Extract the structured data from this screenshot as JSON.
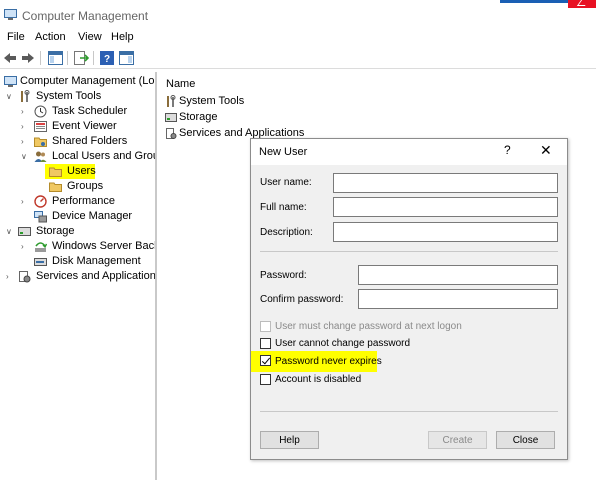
{
  "window": {
    "title": "Computer Management"
  },
  "menu": [
    "File",
    "Action",
    "View",
    "Help"
  ],
  "tree": {
    "root": "Computer Management (Local",
    "system_tools": "System Tools",
    "task_scheduler": "Task Scheduler",
    "event_viewer": "Event Viewer",
    "shared_folders": "Shared Folders",
    "local_users_groups": "Local Users and Groups",
    "users": "Users",
    "groups": "Groups",
    "performance": "Performance",
    "device_manager": "Device Manager",
    "storage": "Storage",
    "windows_server_backup": "Windows Server Backup",
    "disk_management": "Disk Management",
    "services_apps": "Services and Applications"
  },
  "list": {
    "header": "Name",
    "items": [
      "System Tools",
      "Storage",
      "Services and Applications"
    ]
  },
  "dialog": {
    "title": "New User",
    "help_glyph": "?",
    "close_glyph": "✕",
    "fields": {
      "user_name": {
        "label": "User name:",
        "value": ""
      },
      "full_name": {
        "label": "Full name:",
        "value": ""
      },
      "description": {
        "label": "Description:",
        "value": ""
      },
      "password": {
        "label": "Password:",
        "value": ""
      },
      "confirm_password": {
        "label": "Confirm password:",
        "value": ""
      }
    },
    "checkboxes": {
      "must_change": {
        "label": "User must change password at next logon",
        "checked": false,
        "disabled": true
      },
      "cannot_change": {
        "label": "User cannot change password",
        "checked": false,
        "disabled": false
      },
      "never_expires": {
        "label": "Password never expires",
        "checked": true,
        "disabled": false
      },
      "disabled_account": {
        "label": "Account is disabled",
        "checked": false,
        "disabled": false
      }
    },
    "buttons": {
      "help": "Help",
      "create": "Create",
      "close": "Close"
    }
  },
  "colors": {
    "highlight": "#ffff00",
    "folder": "#f0c862",
    "accent_blue": "#1a5fb4"
  }
}
